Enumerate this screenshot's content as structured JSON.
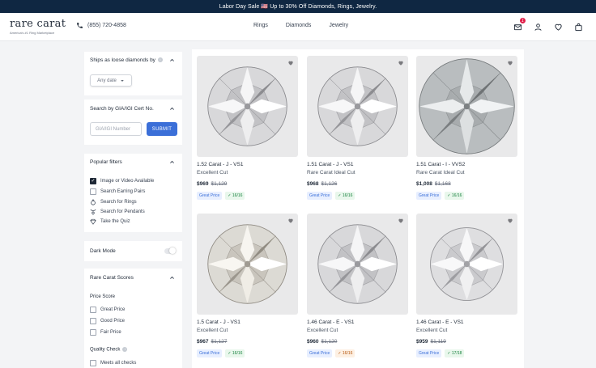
{
  "promo": {
    "text": "Labor Day Sale 🇺🇸 Up to 30% Off Diamonds, Rings, Jewelry."
  },
  "header": {
    "logo": "rare carat",
    "tagline": "America's #1 Ring Marketplace",
    "phone": "(855) 720-4858",
    "nav": [
      "Rings",
      "Diamonds",
      "Jewelry"
    ],
    "cart_count": "1",
    "icons": [
      "mail-icon",
      "user-icon",
      "heart-icon",
      "bag-icon"
    ]
  },
  "sidebar": {
    "ships": {
      "title": "Ships as loose diamonds by",
      "dropdown": "Any date"
    },
    "cert": {
      "title": "Search by GIA/IGI Cert No.",
      "placeholder": "GIA/IGI Number",
      "submit": "SUBMIT"
    },
    "popular": {
      "title": "Popular filters",
      "items": [
        {
          "label": "Image or Video Available",
          "checked": true
        },
        {
          "label": "Search Earring Pairs",
          "checked": false
        },
        {
          "label": "Search for Rings",
          "icon": "ring-icon"
        },
        {
          "label": "Search for Pendants",
          "icon": "pendant-icon"
        },
        {
          "label": "Take the Quiz",
          "icon": "diamond-icon"
        }
      ]
    },
    "dark_mode": {
      "label": "Dark Mode",
      "on": false
    },
    "scores": {
      "title": "Rare Carat Scores",
      "price_score": {
        "title": "Price Score",
        "options": [
          "Great Price",
          "Good Price",
          "Fair Price"
        ]
      },
      "quality_check": {
        "title": "Quality Check",
        "options": [
          "Meets all checks"
        ]
      }
    }
  },
  "products": [
    {
      "title": "1.52 Carat - J - VS1",
      "cut": "Excellent Cut",
      "price": "$969",
      "was": "$1,129",
      "price_tag": "Great Price",
      "qc": "16/16",
      "qc_warn": false
    },
    {
      "title": "1.51 Carat - J - VS1",
      "cut": "Rare Carat Ideal Cut",
      "price": "$968",
      "was": "$1,126",
      "price_tag": "Great Price",
      "qc": "16/16",
      "qc_warn": false
    },
    {
      "title": "1.51 Carat - I - VVS2",
      "cut": "Rare Carat Ideal Cut",
      "price": "$1,008",
      "was": "$1,168",
      "price_tag": "Great Price",
      "qc": "16/16",
      "qc_warn": false
    },
    {
      "title": "1.5 Carat - J - VS1",
      "cut": "Excellent Cut",
      "price": "$967",
      "was": "$1,127",
      "price_tag": "Great Price",
      "qc": "16/16",
      "qc_warn": false
    },
    {
      "title": "1.46 Carat - E - VS1",
      "cut": "Excellent Cut",
      "price": "$960",
      "was": "$1,120",
      "price_tag": "Great Price",
      "qc": "16/16",
      "qc_warn": true
    },
    {
      "title": "1.46 Carat - E - VS1",
      "cut": "Excellent Cut",
      "price": "$959",
      "was": "$1,119",
      "price_tag": "Great Price",
      "qc": "17/18",
      "qc_warn": false
    }
  ]
}
